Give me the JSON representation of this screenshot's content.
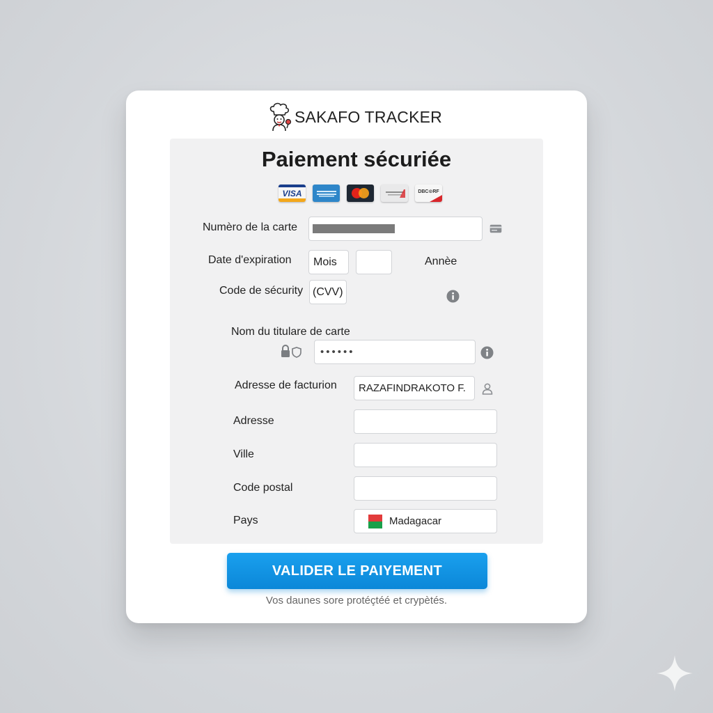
{
  "brand": {
    "name": "SAKAFO TRACKER",
    "logo_icon": "chef-icon"
  },
  "form": {
    "title": "Paiement sécuriée",
    "card_logos": [
      "VISA",
      "",
      "",
      "",
      "DBC⊙RF"
    ],
    "card_number": {
      "label": "Numèro de la carte",
      "icon": "credit-card-icon"
    },
    "expiry": {
      "label": "Date d'expiration",
      "month_value": "Mois",
      "year_value": "",
      "year_label": "Annèe"
    },
    "cvv": {
      "label": "Code de sécurity",
      "value": "(CVV)",
      "icon": "info-icon"
    },
    "holder": {
      "label": "Nom du titulare de carte",
      "value": "••••••",
      "icons": [
        "lock-icon",
        "shield-icon",
        "info-icon"
      ]
    },
    "billing": {
      "label": "Adresse de facturion",
      "value": "RAZAFINDRAKOTO F.",
      "icon": "user-icon"
    },
    "address": {
      "label": "Adresse",
      "value": ""
    },
    "city": {
      "label": "Ville",
      "value": ""
    },
    "postal": {
      "label": "Code postal",
      "value": ""
    },
    "country": {
      "label": "Pays",
      "value": "Madagacar",
      "flag_icon": "madagascar-flag-icon"
    }
  },
  "submit_label": "VALIDER LE PAIYEMENT",
  "footnote": "Vos daunes sore protéçtéé et crypètés.",
  "colors": {
    "accent": "#0b87d8",
    "panel": "#f1f1f2",
    "card": "#ffffff"
  }
}
